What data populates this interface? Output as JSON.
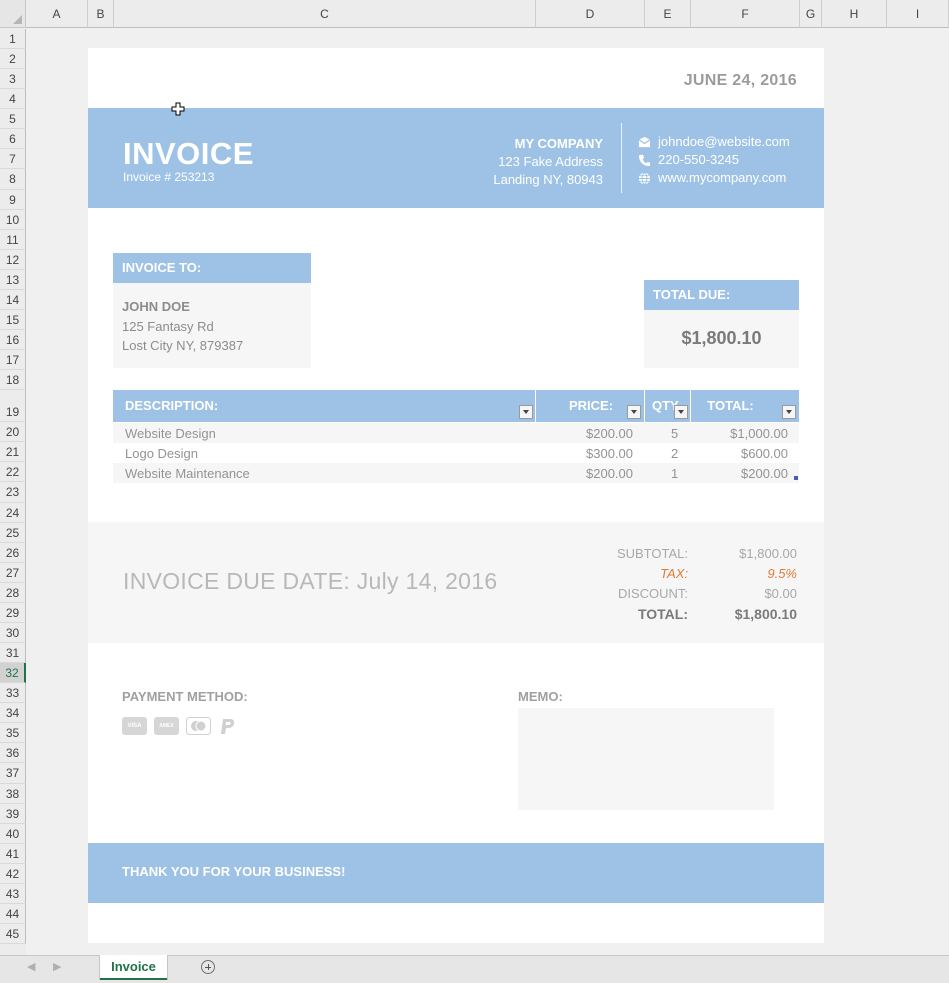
{
  "grid": {
    "columns": [
      "A",
      "B",
      "C",
      "D",
      "E",
      "F",
      "G",
      "H",
      "I"
    ],
    "rows": [
      "1",
      "2",
      "3",
      "4",
      "5",
      "6",
      "7",
      "8",
      "9",
      "10",
      "11",
      "12",
      "13",
      "14",
      "15",
      "16",
      "17",
      "18",
      "19",
      "20",
      "21",
      "22",
      "23",
      "24",
      "25",
      "26",
      "27",
      "28",
      "29",
      "30",
      "31",
      "32",
      "33",
      "34",
      "35",
      "36",
      "37",
      "38",
      "39",
      "40",
      "41",
      "42",
      "43",
      "44",
      "45"
    ],
    "active_row": "32"
  },
  "invoice": {
    "date": "JUNE 24, 2016",
    "title": "INVOICE",
    "number": "Invoice # 253213",
    "company": {
      "name": "MY COMPANY",
      "address1": "123 Fake Address",
      "address2": "Landing NY, 80943"
    },
    "contact": {
      "email": "johndoe@website.com",
      "phone": "220-550-3245",
      "web": "www.mycompany.com"
    },
    "bill_to": {
      "label": "INVOICE TO:",
      "name": "JOHN DOE",
      "address1": "125 Fantasy Rd",
      "address2": "Lost City NY, 879387"
    },
    "total_due": {
      "label": "TOTAL DUE:",
      "amount": "$1,800.10"
    },
    "table": {
      "headers": {
        "description": "DESCRIPTION:",
        "price": "PRICE:",
        "qty": "QTY",
        "total": "TOTAL:"
      },
      "rows": [
        {
          "description": "Website Design",
          "price": "$200.00",
          "qty": "5",
          "total": "$1,000.00"
        },
        {
          "description": "Logo Design",
          "price": "$300.00",
          "qty": "2",
          "total": "$600.00"
        },
        {
          "description": "Website Maintenance",
          "price": "$200.00",
          "qty": "1",
          "total": "$200.00"
        }
      ]
    },
    "due_date": "INVOICE DUE DATE: July 14, 2016",
    "summary": {
      "subtotal_label": "SUBTOTAL:",
      "subtotal": "$1,800.00",
      "tax_label": "TAX:",
      "tax": "9.5%",
      "discount_label": "DISCOUNT:",
      "discount": "$0.00",
      "total_label": "TOTAL:",
      "total": "$1,800.10"
    },
    "payment_method_label": "PAYMENT METHOD:",
    "payment_icons": [
      "visa-icon",
      "amex-icon",
      "mastercard-icon",
      "paypal-icon"
    ],
    "payment_icon_text": {
      "visa": "VISA",
      "amex": "AMEX"
    },
    "memo_label": "MEMO:",
    "thank_you": "THANK YOU FOR YOUR BUSINESS!"
  },
  "sheet_tabs": {
    "active": "Invoice"
  },
  "colors": {
    "accent": "#9ec2e6",
    "excel_green": "#217346",
    "tax_orange": "#e07b39"
  }
}
